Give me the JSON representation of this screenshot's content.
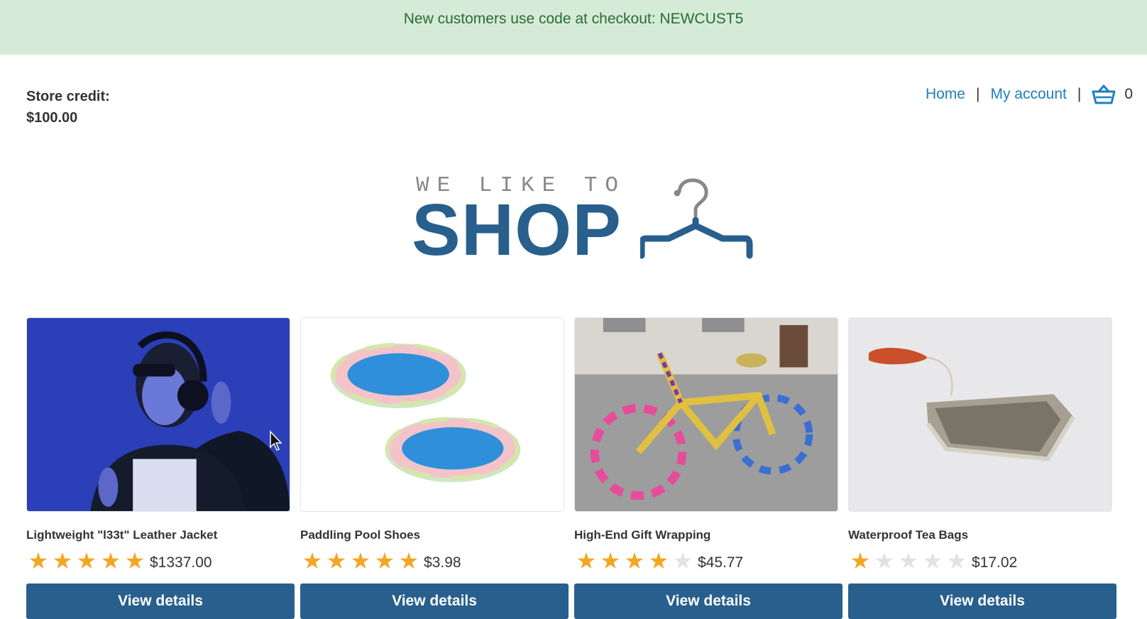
{
  "banner": {
    "text": "New customers use code at checkout: NEWCUST5"
  },
  "account": {
    "credit_label": "Store credit:",
    "credit_value": "$100.00"
  },
  "nav": {
    "home": "Home",
    "separator": "|",
    "account": "My account",
    "cart_icon": "basket-icon",
    "cart_count": "0"
  },
  "logo": {
    "tagline": "WE LIKE TO",
    "word": "SHOP",
    "icon": "hanger-icon"
  },
  "colors": {
    "brand": "#285f8c",
    "link": "#1f7ec1",
    "star": "#f4a623",
    "banner_bg": "#d5ebd7",
    "banner_text": "#2b6b35"
  },
  "products": [
    {
      "name": "Lightweight \"l33t\" Leather Jacket",
      "rating": 5,
      "price": "$1337.00",
      "button": "View details",
      "image": "person-headphones-image"
    },
    {
      "name": "Paddling Pool Shoes",
      "rating": 5,
      "price": "$3.98",
      "button": "View details",
      "image": "paddling-pools-image"
    },
    {
      "name": "High-End Gift Wrapping",
      "rating": 4,
      "price": "$45.77",
      "button": "View details",
      "image": "knitted-bicycle-image"
    },
    {
      "name": "Waterproof Tea Bags",
      "rating": 1,
      "price": "$17.02",
      "button": "View details",
      "image": "tea-bag-image"
    }
  ]
}
